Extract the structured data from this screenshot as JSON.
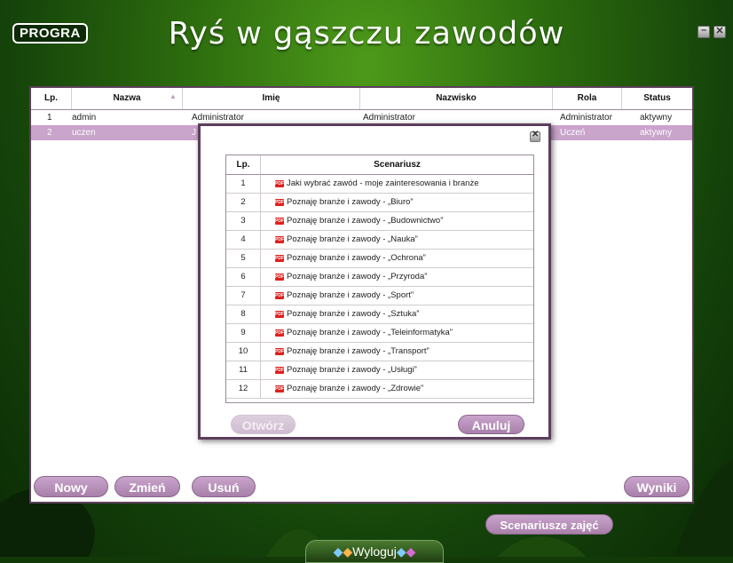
{
  "app": {
    "logo": "PROGRA",
    "title": "Ryś w gąszczu zawodów"
  },
  "users_table": {
    "headers": [
      "Lp.",
      "Nazwa",
      "Imię",
      "Nazwisko",
      "Rola",
      "Status"
    ],
    "rows": [
      {
        "lp": "1",
        "nazwa": "admin",
        "imie": "Administrator",
        "nazwisko": "Administrator",
        "rola": "Administrator",
        "status": "aktywny"
      },
      {
        "lp": "2",
        "nazwa": "uczen",
        "imie": "J",
        "nazwisko": "",
        "rola": "Uczeń",
        "status": "aktywny"
      }
    ]
  },
  "buttons": {
    "new": "Nowy",
    "edit": "Zmień",
    "delete": "Usuń",
    "results": "Wyniki",
    "scenarios": "Scenariusze zajęć",
    "logout": "Wyloguj"
  },
  "dialog": {
    "headers": [
      "Lp.",
      "Scenariusz"
    ],
    "rows": [
      {
        "lp": "1",
        "text": "Jaki wybrać zawód - moje zainteresowania i branże"
      },
      {
        "lp": "2",
        "text": "Poznaję branże i zawody - „Biuro”"
      },
      {
        "lp": "3",
        "text": "Poznaję branże i zawody - „Budownictwo”"
      },
      {
        "lp": "4",
        "text": "Poznaję branże i zawody - „Nauka”"
      },
      {
        "lp": "5",
        "text": "Poznaję branże i zawody - „Ochrona”"
      },
      {
        "lp": "6",
        "text": "Poznaję branże i zawody - „Przyroda”"
      },
      {
        "lp": "7",
        "text": "Poznaję branże i zawody - „Sport”"
      },
      {
        "lp": "8",
        "text": "Poznaję branże i zawody - „Sztuka”"
      },
      {
        "lp": "9",
        "text": "Poznaję branże i zawody - „Teleinformatyka”"
      },
      {
        "lp": "10",
        "text": "Poznaję branże i zawody - „Transport”"
      },
      {
        "lp": "11",
        "text": "Poznaję branże i zawody - „Usługi”"
      },
      {
        "lp": "12",
        "text": "Poznaję branże i zawody - „Zdrowie”"
      }
    ],
    "open": "Otwórz",
    "cancel": "Anuluj",
    "pdf_label": "PDF"
  },
  "colors": {
    "accent": "#a880aa",
    "selected_row": "#c9a4cb",
    "frame": "#5c3e5b",
    "pdf_icon": "#e0201c"
  }
}
